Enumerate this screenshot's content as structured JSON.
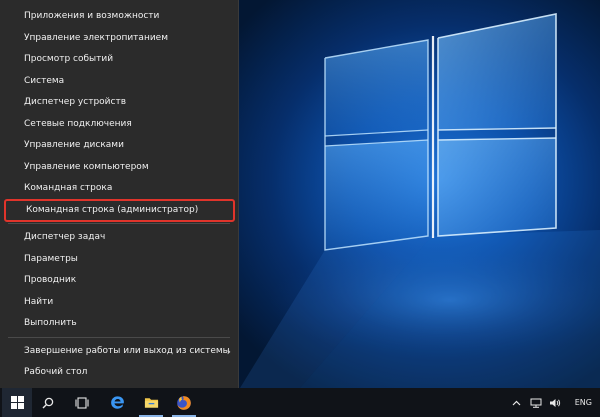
{
  "menu": {
    "items": [
      {
        "label": "Приложения и возможности",
        "group": 1
      },
      {
        "label": "Управление электропитанием",
        "group": 1
      },
      {
        "label": "Просмотр событий",
        "group": 1
      },
      {
        "label": "Система",
        "group": 1
      },
      {
        "label": "Диспетчер устройств",
        "group": 1
      },
      {
        "label": "Сетевые подключения",
        "group": 1
      },
      {
        "label": "Управление дисками",
        "group": 1
      },
      {
        "label": "Управление компьютером",
        "group": 1
      },
      {
        "label": "Командная строка",
        "group": 1
      },
      {
        "label": "Командная строка (администратор)",
        "group": 1,
        "highlighted": true
      },
      {
        "label": "Диспетчер задач",
        "group": 2
      },
      {
        "label": "Параметры",
        "group": 2
      },
      {
        "label": "Проводник",
        "group": 2
      },
      {
        "label": "Найти",
        "group": 2
      },
      {
        "label": "Выполнить",
        "group": 2
      },
      {
        "label": "Завершение работы или выход из системы",
        "group": 3,
        "submenu": true
      },
      {
        "label": "Рабочий стол",
        "group": 3
      }
    ],
    "chevron": "›",
    "highlight_color": "#e0342b"
  },
  "taskbar": {
    "icons": [
      "windows-start-icon",
      "search-icon",
      "task-view-icon",
      "edge-icon",
      "file-explorer-icon",
      "firefox-icon"
    ],
    "tray": {
      "lang": "ENG",
      "icons": [
        "chevron-up-icon",
        "network-icon",
        "volume-icon"
      ]
    }
  },
  "colors": {
    "menu_bg": "#2b2b2b",
    "taskbar_bg": "#101318",
    "wallpaper_glow": "#1f73d6"
  }
}
